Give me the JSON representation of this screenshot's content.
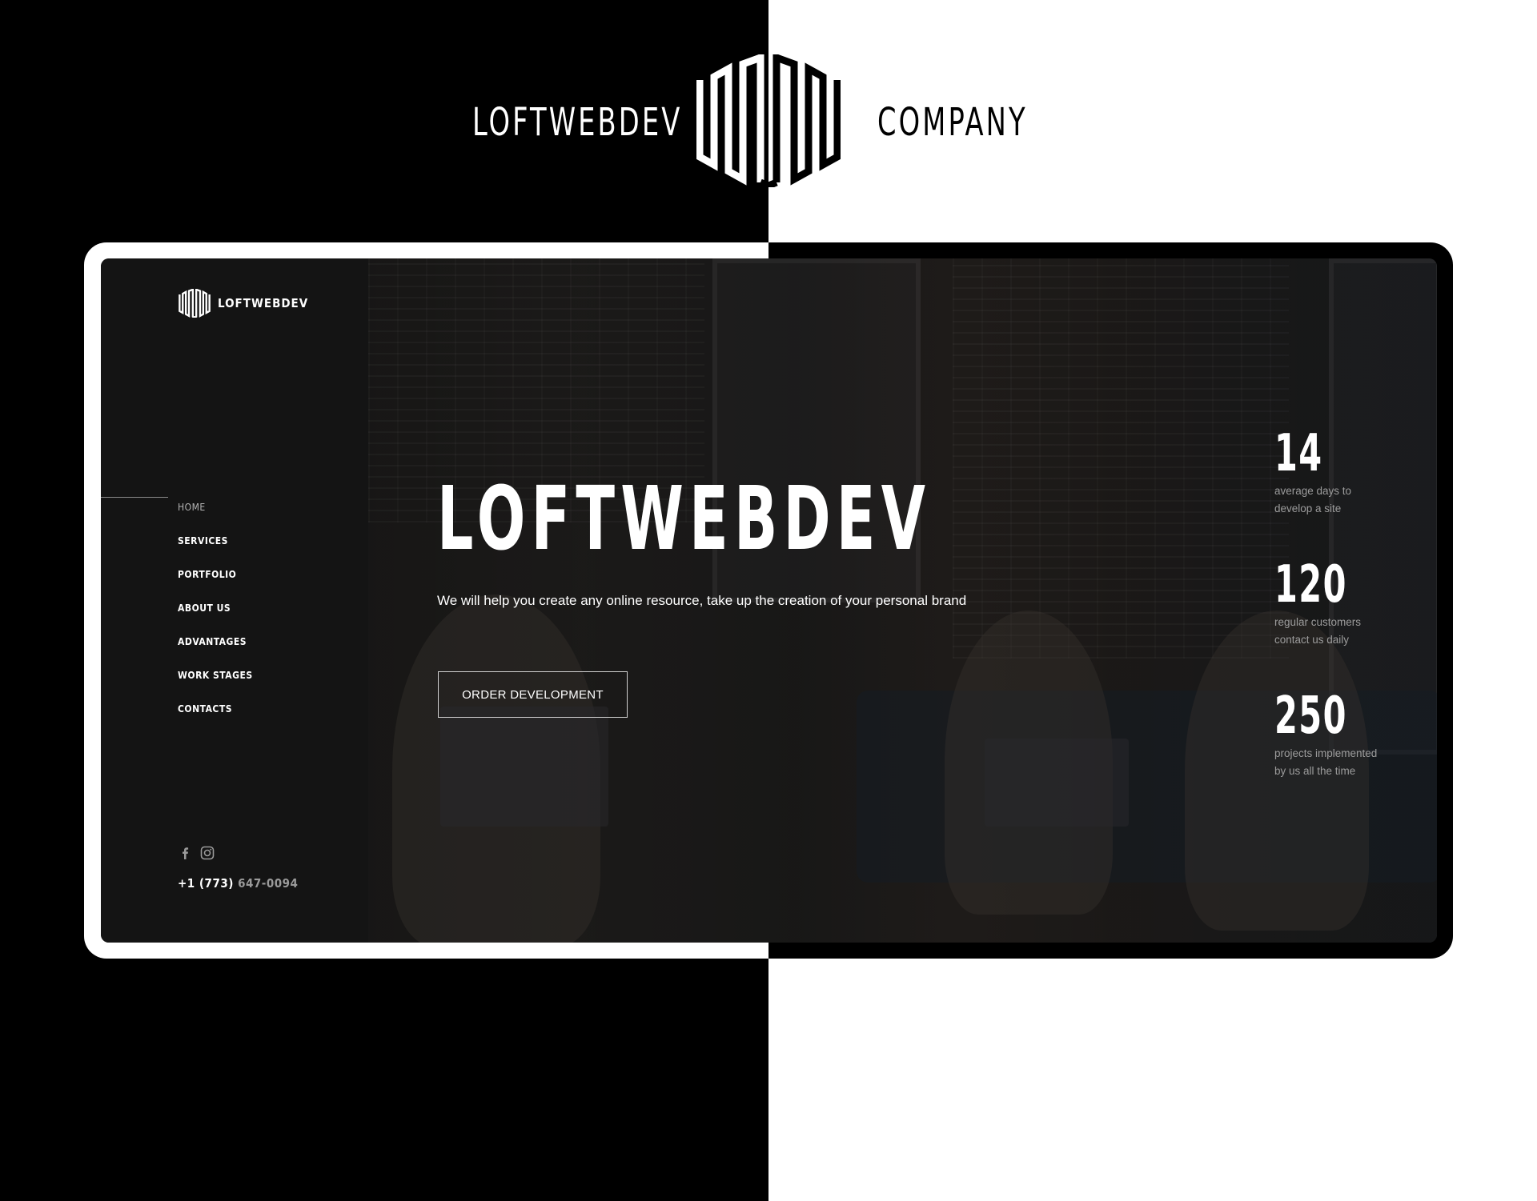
{
  "header": {
    "brand_left": "LOFTWEBDEV",
    "brand_right": "COMPANY"
  },
  "sidebar": {
    "logo_text": "LOFTWEBDEV",
    "nav": [
      {
        "label": "HOME",
        "active": true
      },
      {
        "label": "SERVICES"
      },
      {
        "label": "PORTFOLIO"
      },
      {
        "label": "ABOUT US"
      },
      {
        "label": "ADVANTAGES"
      },
      {
        "label": "WORK STAGES"
      },
      {
        "label": "CONTACTS"
      }
    ],
    "socials": [
      "facebook-icon",
      "instagram-icon"
    ],
    "phone_prefix": "+1 (773)",
    "phone_number": "647-0094"
  },
  "hero": {
    "title": "LOFTWEBDEV",
    "subtitle": "We will help you create any online resource, take up the creation of your personal brand",
    "cta_label": "ORDER DEVELOPMENT"
  },
  "stats": [
    {
      "value": "14",
      "line1": "average days to",
      "line2": "develop a site"
    },
    {
      "value": "120",
      "line1": "regular customers",
      "line2": "contact us daily"
    },
    {
      "value": "250",
      "line1": "projects implemented",
      "line2": "by us all the time"
    }
  ],
  "colors": {
    "background_left": "#000000",
    "background_right": "#ffffff",
    "sidebar": "#141414",
    "text": "#ffffff",
    "muted": "#9c9c9c"
  }
}
